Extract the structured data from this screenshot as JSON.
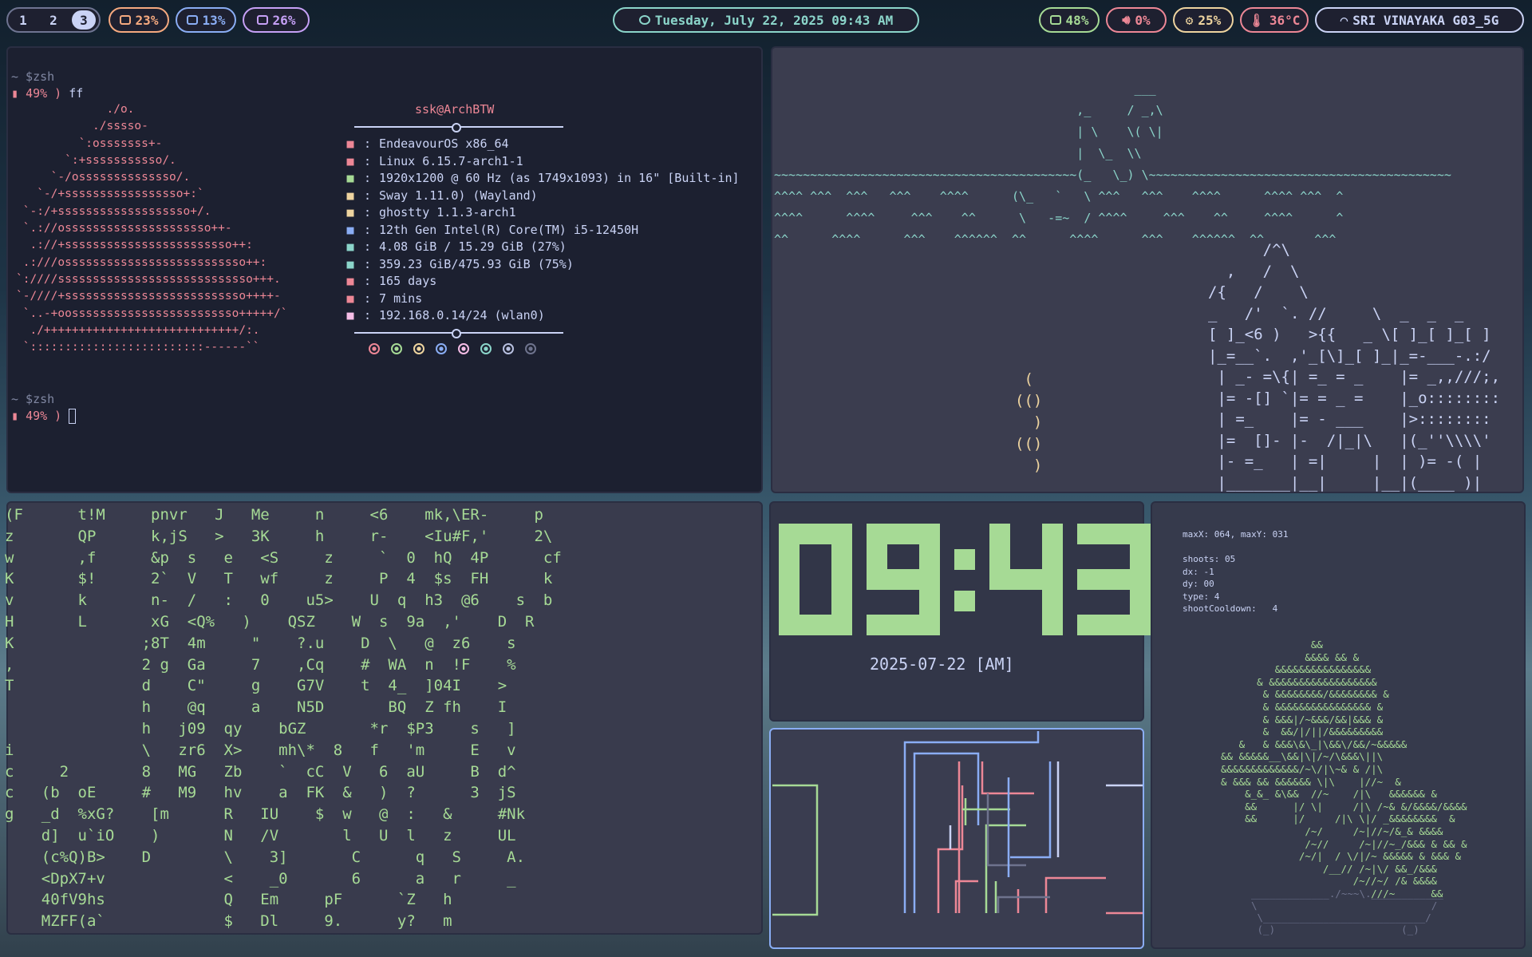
{
  "topbar": {
    "workspaces": [
      "1",
      "2",
      "3"
    ],
    "active_workspace": "3",
    "disk": "23%",
    "cpu": "13%",
    "memory": "26%",
    "datetime": "Tuesday, July 22, 2025 09:43 AM",
    "battery": "48%",
    "volume": "0%",
    "brightness": "25%",
    "temperature": "36°C",
    "wifi": "SRI VINAYAKA G03_5G",
    "colors": {
      "disk": "#f5a97f",
      "cpu": "#8aadf4",
      "memory": "#c6a0f6",
      "clock": "#8bd5ca",
      "battery": "#a6da95",
      "volume": "#ed8796",
      "brightness": "#eed49f",
      "temperature": "#ed8796",
      "wifi": "#cad3f5"
    },
    "icons": [
      "disk-icon",
      "cpu-icon",
      "memory-icon",
      "clock-icon",
      "battery-icon",
      "volume-icon",
      "brightness-icon",
      "thermometer-icon",
      "wifi-icon"
    ]
  },
  "terminal1": {
    "prompt_dir": "~ $zsh",
    "prompt_battery": "49% ) ",
    "command": "ff",
    "userhost": "ssk@ArchBTW",
    "info": [
      {
        "icon": "os-icon",
        "value": "EndeavourOS x86_64",
        "color": "#ed8796"
      },
      {
        "icon": "kernel-icon",
        "value": "Linux 6.15.7-arch1-1",
        "color": "#ed8796"
      },
      {
        "icon": "display-icon",
        "value": "1920x1200 @ 60 Hz (as 1749x1093) in 16\" [Built-in]",
        "color": "#a6da95"
      },
      {
        "icon": "wm-icon",
        "value": "Sway 1.11.0) (Wayland)",
        "color": "#eed49f"
      },
      {
        "icon": "terminal-icon",
        "value": "ghostty 1.1.3-arch1",
        "color": "#eed49f"
      },
      {
        "icon": "cpu-icon",
        "value": "12th Gen Intel(R) Core(TM) i5-12450H",
        "color": "#8aadf4"
      },
      {
        "icon": "memory-icon",
        "value": "4.08 GiB / 15.29 GiB (27%)",
        "color": "#8bd5ca"
      },
      {
        "icon": "disk-icon",
        "value": "359.23 GiB/475.93 GiB (75%)",
        "color": "#8bd5ca"
      },
      {
        "icon": "uptime-icon",
        "value": "165 days",
        "color": "#ed8796"
      },
      {
        "icon": "packages-icon",
        "value": "7 mins",
        "color": "#ed8796"
      },
      {
        "icon": "ip-icon",
        "value": "192.168.0.14/24 (wlan0)",
        "color": "#f5bde6"
      }
    ],
    "palette": [
      "#ed8796",
      "#a6da95",
      "#eed49f",
      "#8aadf4",
      "#f5bde6",
      "#8bd5ca",
      "#b8c0e0",
      "#6e738d"
    ],
    "logo": "             ./o.\n           ./sssso-\n         `:osssssss+-\n       `:+sssssssssso/.\n     `-/ossssssssssssso/.\n   `-/+sssssssssssssssso+:`\n `-:/+sssssssssssssssssso+/.\n `.://osssssssssssssssssssso++-\n  .://+ssssssssssssssssssssssso++:\n .:///ossssssssssssssssssssssssso++:\n`:////ssssssssssssssssssssssssssso+++.\n`-////+ssssssssssssssssssssssssso++++-\n `..-+oossssssssssssssssssssssso+++++/`\n  ./++++++++++++++++++++++++++++/:.\n `:::::::::::::::::::::::::------``"
  },
  "terminal2": {
    "art": "                                                  ___\n                                          ,_     / _,\\\n                                          | \\    \\( \\|\n                                          |  \\_  \\\\\n~~~~~~~~~~~~~~~~~~~~~~~~~~~~~~~~~~~~~~~~~~(_   \\_) \\~~~~~~~~~~~~~~~~~~~~~~~~~~~~~~~~~~~~~~~~~~\n^^^^ ^^^  ^^^   ^^^    ^^^^      (\\_   `   \\ ^^^   ^^^    ^^^^      ^^^^ ^^^  ^\n^^^^      ^^^^     ^^^    ^^      \\   -=~  / ^^^^     ^^^    ^^     ^^^^      ^\n^^      ^^^^      ^^^    ^^^^^^  ^^      ^^^^      ^^^    ^^^^^^  ^^       ^^^",
    "castle": "      /^\\\n  ,   /  \\\n/{   /    \\\n_   /'  `. //     \\  _  _  _\n[ ]_<6 )   >{{   _ \\[ ]_[ ]_[ ]\n|_=__`.  ,'_[\\]_[ ]_|_=-___-.:/\n | _- =\\{| =_ = _    |= _,,///;,\n |= -[] `|= = _ =    |_o::::::::\n | =_    |= - ___    |>::::::::\n |=  []- |-  /|_|\\   |(_''\\\\\\\\'\n |- =_   | =|     |  | )= -( |\n |_______|__|     |__|(____ )|",
    "smoke": " (\n(()\n  )\n(()\n  )"
  },
  "terminal3": {
    "rain": "(F      t!M     pnvr   J   Me     n     <6    mk,\\ER-     p\nz       QP      k,jS   >   3K     h     r-    <Iu#F,'     2\\\nw       ,f      &p  s   e   <S     z     `  0  hQ  4P      cf\nK       $!      2`  V   T   wf     z     P  4  $s  FH      k\nv       k       n-  /   :   0    u5>    U  q  h3  @6    s  b\nH       L       xG  <Q%   )    QSZ    W  s  9a  ,'    D  R\nK              ;8T  4m     \"    ?.u    D  \\   @  z6    s\n,              2 g  Ga     7    ,Cq    #  WA  n  !F    %\nT              d    C\"     g    G7V    t  4_  ]04I    >\n               h    @q     a    N5D       BQ  Z fh    I\n               h   j09  qy    bGZ       *r  $P3    s   ]\ni              \\   zr6  X>    mh\\*  8   f   'm     E   v\nc     2        8   MG   Zb    `  cC  V   6  aU     B  d^\nc   (b  oE     #   M9   hv    a  FK  &   )  ?      3  jS\ng   _d  %xG?    [m      R   IU    $  w   @  :   &     #Nk\n    d]  u`iO    )       N   /V       l   U  l   z     UL\n    (c%Q)B>    D        \\    3]       C      q   S     A.\n    <DpX7+v             <    _0       6      a   r     _\n    40fV9hs             Q   Em     pF      `Z   h\n    MZFF(a`             $   Dl     9.      y?   m"
  },
  "clock_panel": {
    "time": "09:43",
    "date": "2025-07-22 [AM]",
    "digit_color": "#a6da95"
  },
  "game_panel": {
    "stats": "maxX: 064, maxY: 031\n\nshoots: 05\ndx: -1\ndy: 00\ntype: 4\nshootCooldown:   4",
    "bonsai": "               &&\n              &&&& && &\n         &&&&&&&&&&&&&&&&\n      & &&&&&&&&&&&&&&&&&&\n       & &&&&&&&&/&&&&&&&& &\n       & &&&&&&&&&&&&&&&& &\n       & &&&|/~&&&/&&|&&& &\n       &  &&/|/||/&&&&&&&&&\n   &   & &&&\\&\\_|\\&&\\/&&/~&&&&&\n&& &&&&&__\\&&|\\|/~/\\&&&\\||\\\n&&&&&&&&&&&&&/~\\/|\\~& & /|\\\n& &&& && &&&&&& \\|\\    |//~  &\n    &_&_ &\\&&  //~    /|\\   &&&&&& &\n    &&      |/ \\|     /|\\ /~& &/&&&&/&&&&\n    &&      |/     /|\\ \\|/ _&&&&&&&&  &\n              /~/     /~|//~/&_& &&&&\n              /~//     /~|//~_/&&& & && &\n             /~/|  / \\/|/~ &&&&& & &&& &\n                 /__// /~|\\/ &&_/&&&\n                      /~//~/ /& &&&&\n                         ///~      &&",
    "pot": "_____________./~~~\\.____________\n\\                             /\n \\___________________________/\n (_)                     (_)"
  }
}
